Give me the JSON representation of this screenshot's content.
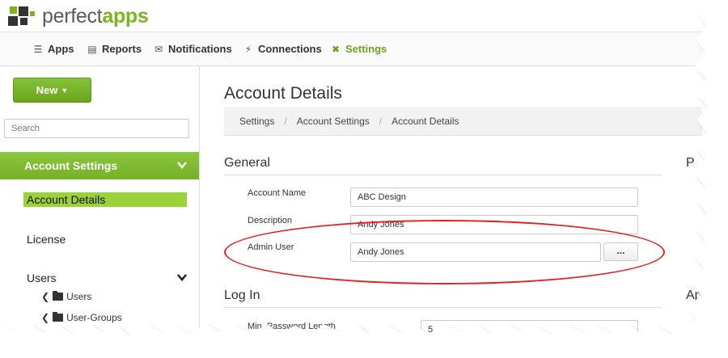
{
  "brand": {
    "name_plain": "perfect",
    "name_bold": "apps"
  },
  "nav": {
    "items": [
      {
        "label": "Apps",
        "icon": "apps-list-icon"
      },
      {
        "label": "Reports",
        "icon": "bar-chart-icon"
      },
      {
        "label": "Notifications",
        "icon": "inbox-icon"
      },
      {
        "label": "Connections",
        "icon": "plug-icon"
      },
      {
        "label": "Settings",
        "icon": "tools-icon",
        "active": true
      }
    ]
  },
  "sidebar": {
    "new_label": "New",
    "search_placeholder": "Search",
    "section": "Account Settings",
    "items": {
      "account_details": "Account Details",
      "license": "License",
      "users": "Users",
      "users_sub": "Users",
      "user_groups_sub": "User-Groups"
    }
  },
  "main": {
    "title": "Account Details",
    "breadcrumb": [
      "Settings",
      "Account Settings",
      "Account Details"
    ],
    "general": {
      "title": "General",
      "account_name_label": "Account Name",
      "account_name_value": "ABC Design",
      "description_label": "Description",
      "description_value": "Andy Jones",
      "admin_user_label": "Admin User",
      "admin_user_value": "Andy Jones",
      "browse_label": "..."
    },
    "login": {
      "title": "Log In",
      "min_pw_label": "Min. Password Length",
      "min_pw_value": "5"
    },
    "right_col_title_1": "P",
    "right_col_title_2": "Ap"
  },
  "colors": {
    "accent": "#7ab51d",
    "highlight": "#e32020"
  }
}
